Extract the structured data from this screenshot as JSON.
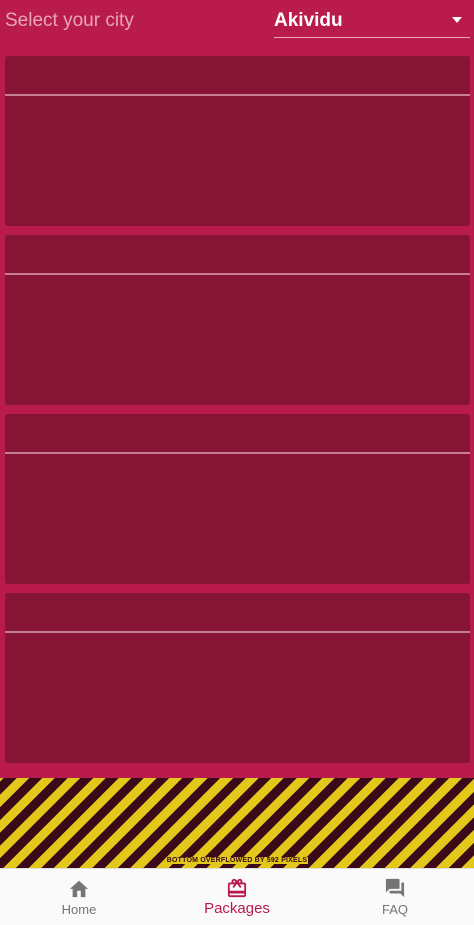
{
  "city_selector": {
    "label": "Select your city",
    "selected_value": "Akividu",
    "dropdown_icon": "arrow-drop-down-icon"
  },
  "package_cards_count": 4,
  "overflow_warning": "BOTTOM OVERFLOWED BY 592 PIXELS",
  "bottom_nav": {
    "items": [
      {
        "label": "Home",
        "icon": "home-icon",
        "active": false
      },
      {
        "label": "Packages",
        "icon": "card-giftcard-icon",
        "active": true
      },
      {
        "label": "FAQ",
        "icon": "forum-icon",
        "active": false
      }
    ]
  },
  "colors": {
    "primary": "#b81b4c",
    "card": "#861434",
    "card_divider": "#c57e93",
    "warning_yellow": "#e4c71b",
    "warning_dark": "#3a0a18",
    "nav_active": "#b81b4c",
    "nav_inactive": "#757575"
  }
}
